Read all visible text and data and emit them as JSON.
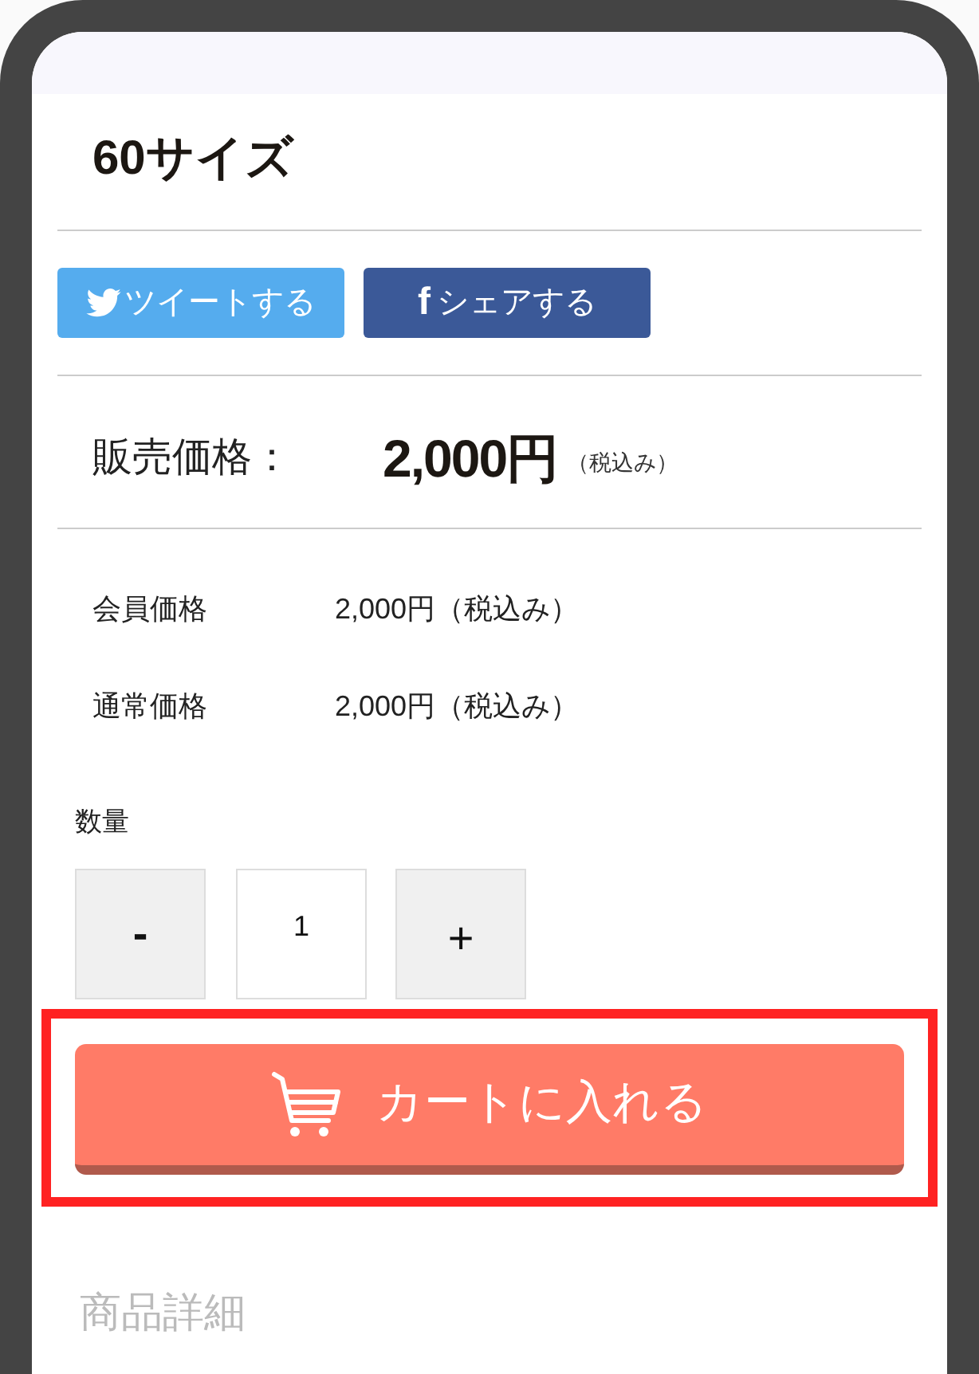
{
  "title": "60サイズ",
  "share_buttons": [
    {
      "kind": "twitter",
      "label": "ツイートする"
    },
    {
      "kind": "facebook",
      "icon_text": "f",
      "label": "シェアする"
    }
  ],
  "sale_price": {
    "label": "販売価格：",
    "price": "2,000円",
    "tax_note": "（税込み）"
  },
  "prices": [
    {
      "label": "会員価格",
      "value": "2,000円（税込み）"
    },
    {
      "label": "通常価格",
      "value": "2,000円（税込み）"
    }
  ],
  "quantity": {
    "label": "数量",
    "decrement": "-",
    "value": "1",
    "increment": "+"
  },
  "cart_button": {
    "label": "カートに入れる",
    "highlighted": true
  },
  "section_heading": "商品詳細"
}
